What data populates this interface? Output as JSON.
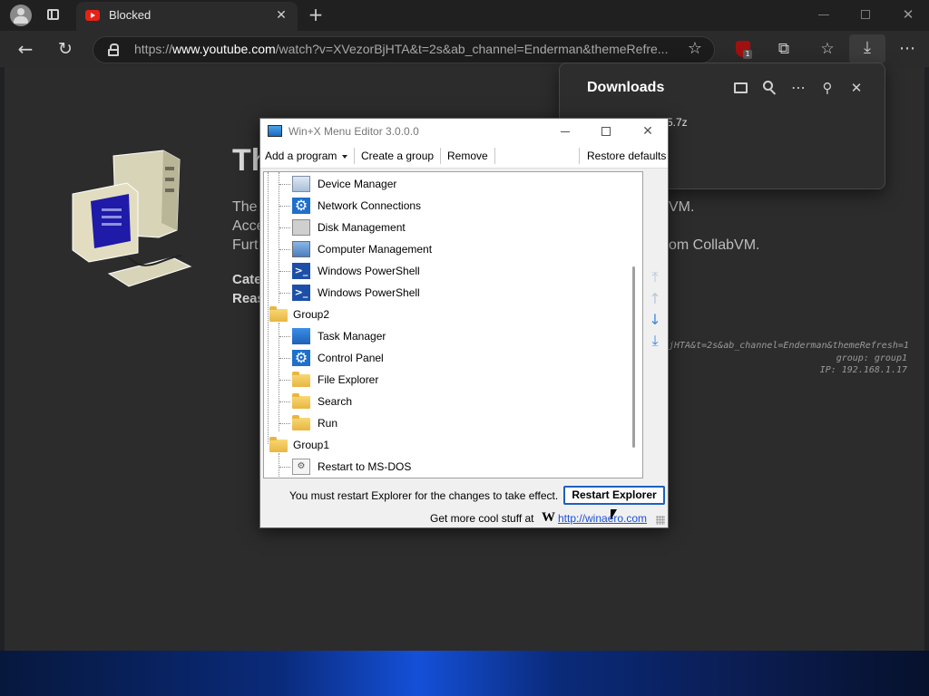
{
  "browser": {
    "tab_title": "Blocked",
    "url_prefix": "https://",
    "url_host": "www.youtube.com",
    "url_rest": "/watch?v=XVezorBjHTA&t=2s&ab_channel=Enderman&themeRefre...",
    "extension_badge": "1",
    "icons": {
      "profile": "profile-avatar-icon",
      "tab_actions": "tab-actions-icon",
      "close_tab": "close-icon",
      "new_tab": "plus-icon",
      "back": "back-arrow-icon",
      "refresh": "refresh-icon",
      "lock": "lock-icon",
      "favorite": "star-icon",
      "extensions": "puzzle-icon",
      "favorites": "favorites-icon",
      "download": "download-icon",
      "more": "more-icon"
    }
  },
  "page": {
    "heading": "Th",
    "line1_start": "The",
    "line1_end": "VM.",
    "line2_start": "Acce",
    "line3_start": "Furt",
    "line3_end": "om CollabVM.",
    "bold1": "Cate",
    "bold2": "Reas",
    "debug_line1": "jHTA&t=2s&ab_channel=Enderman&themeRefresh=1",
    "debug_line2": "group: group1",
    "debug_line3": "IP: 192.168.1.17"
  },
  "downloads": {
    "title": "Downloads",
    "file_partial": "5.7z"
  },
  "dialog": {
    "title": "Win+X Menu Editor 3.0.0.0",
    "menu": {
      "add_program": "Add a program",
      "create_group": "Create a group",
      "remove": "Remove",
      "restore_defaults": "Restore defaults"
    },
    "tree": [
      {
        "label": "Device Manager",
        "level": 1,
        "icon": "device-manager-icon"
      },
      {
        "label": "Network Connections",
        "level": 1,
        "icon": "gear-icon"
      },
      {
        "label": "Disk Management",
        "level": 1,
        "icon": "disk-icon"
      },
      {
        "label": "Computer Management",
        "level": 1,
        "icon": "computer-icon"
      },
      {
        "label": "Windows PowerShell",
        "level": 1,
        "icon": "powershell-icon"
      },
      {
        "label": "Windows PowerShell",
        "level": 1,
        "icon": "powershell-icon"
      },
      {
        "label": "Group2",
        "level": 0,
        "icon": "folder-icon"
      },
      {
        "label": "Task Manager",
        "level": 1,
        "icon": "task-manager-icon"
      },
      {
        "label": "Control Panel",
        "level": 1,
        "icon": "gear-icon"
      },
      {
        "label": "File Explorer",
        "level": 1,
        "icon": "folder-icon"
      },
      {
        "label": "Search",
        "level": 1,
        "icon": "folder-icon"
      },
      {
        "label": "Run",
        "level": 1,
        "icon": "folder-icon"
      },
      {
        "label": "Group1",
        "level": 0,
        "icon": "folder-icon"
      },
      {
        "label": "Restart to MS-DOS",
        "level": 1,
        "icon": "msdos-icon"
      }
    ],
    "restart_notice": "You must restart Explorer for the changes to take effect.",
    "restart_button": "Restart Explorer",
    "footer_text": "Get more cool stuff at",
    "footer_logo": "W",
    "footer_link": "http://winaero.com"
  }
}
